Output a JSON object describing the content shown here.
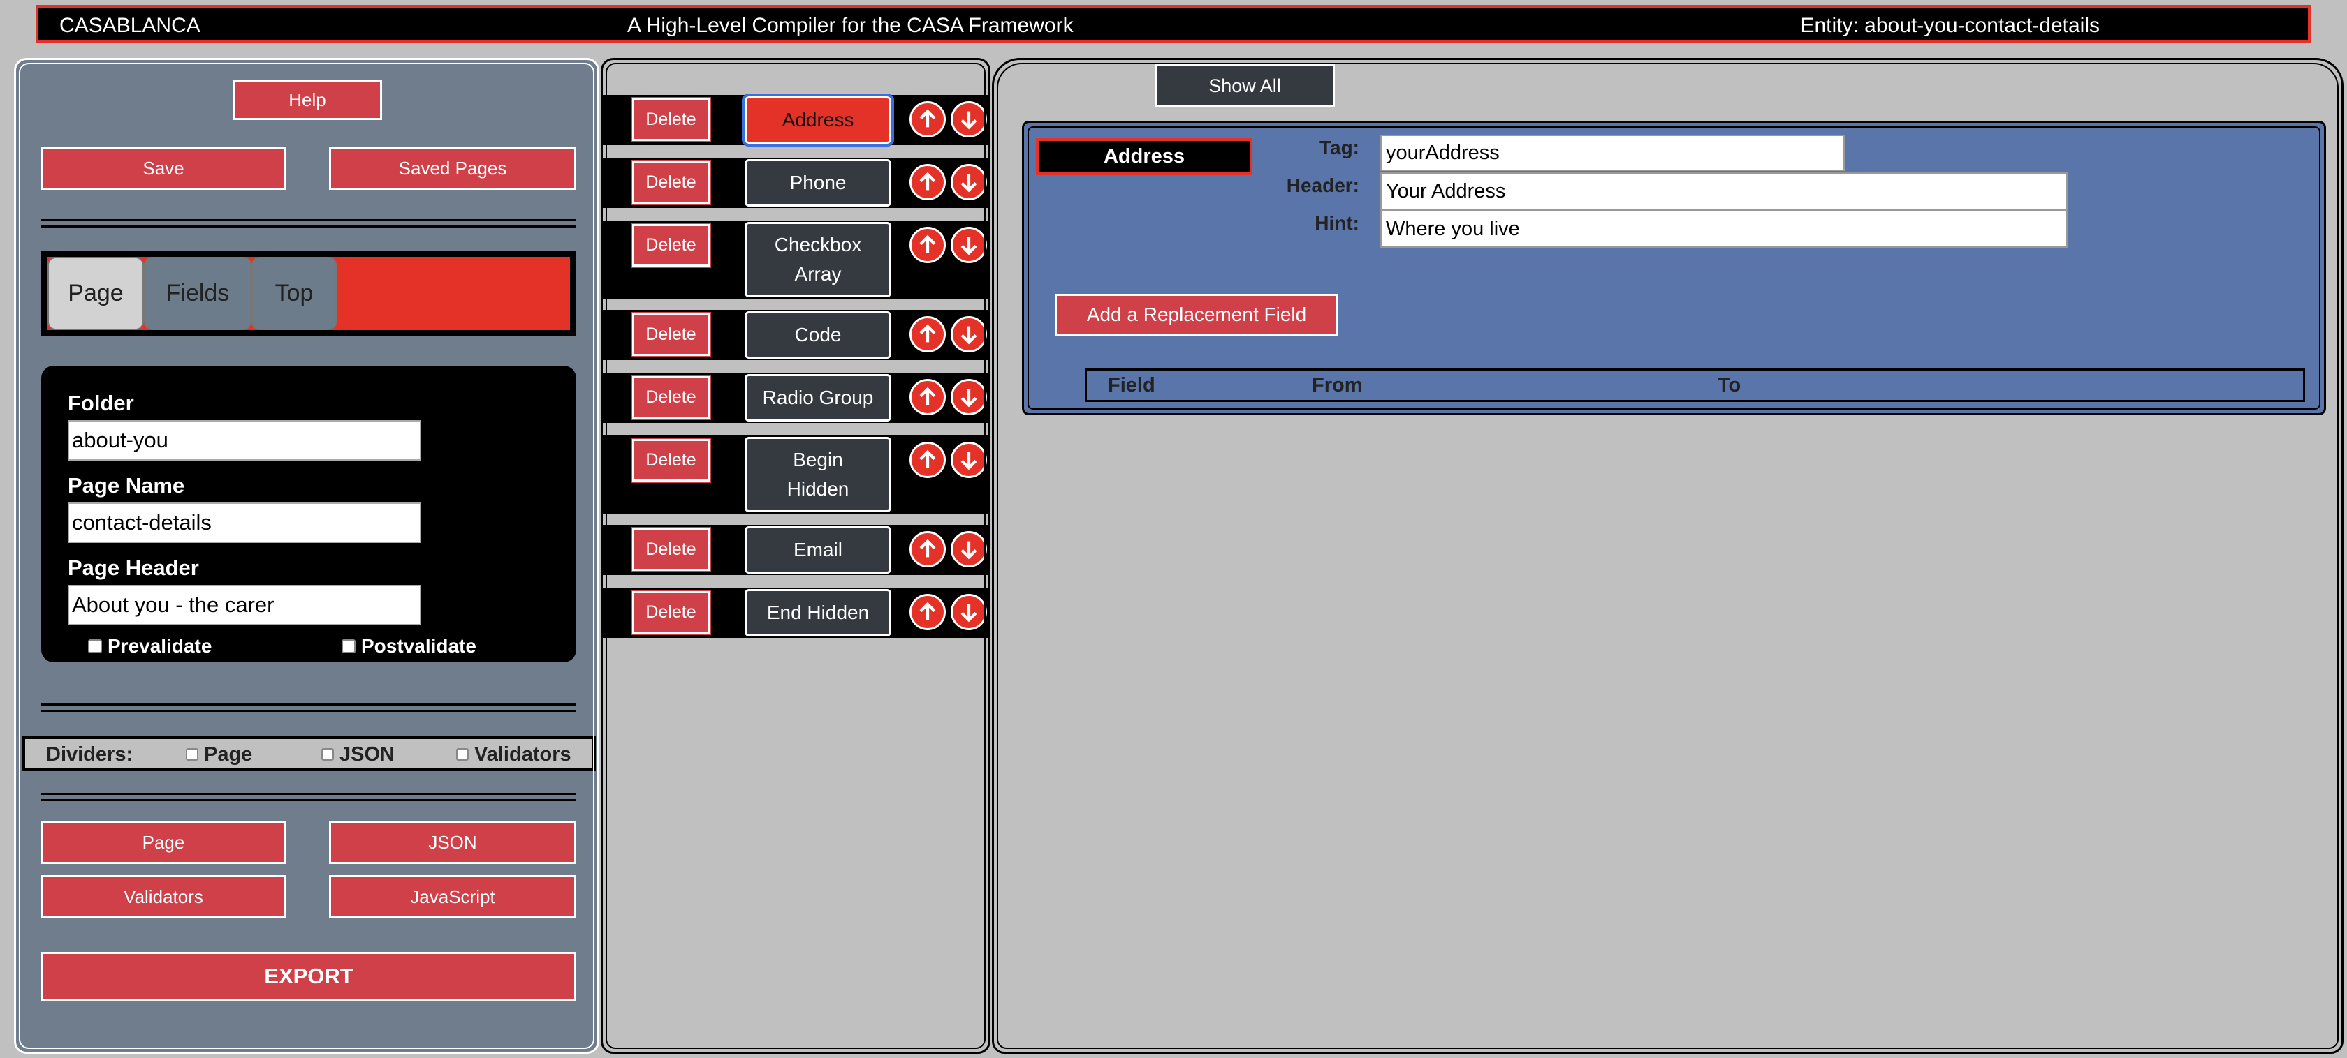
{
  "topbar": {
    "app_name": "CASABLANCA",
    "subtitle": "A High-Level Compiler for the CASA Framework",
    "entity": "Entity: about-you-contact-details"
  },
  "left": {
    "help_label": "Help",
    "save_label": "Save",
    "saved_pages_label": "Saved Pages",
    "tabs": [
      {
        "label": "Page",
        "active": true
      },
      {
        "label": "Fields",
        "active": false
      },
      {
        "label": "Top",
        "active": false
      }
    ],
    "form": {
      "folder_label": "Folder",
      "folder_value": "about-you",
      "page_name_label": "Page Name",
      "page_name_value": "contact-details",
      "page_header_label": "Page Header",
      "page_header_value": "About you - the carer",
      "prevalidate_label": "Prevalidate",
      "postvalidate_label": "Postvalidate"
    },
    "dividers": {
      "label": "Dividers:",
      "options": [
        "Page",
        "JSON",
        "Validators"
      ]
    },
    "buttons": {
      "page": "Page",
      "json": "JSON",
      "validators": "Validators",
      "javascript": "JavaScript",
      "export": "EXPORT"
    }
  },
  "fields_list": {
    "delete_label": "Delete",
    "items": [
      {
        "label": "Address",
        "selected": true
      },
      {
        "label": "Phone",
        "selected": false
      },
      {
        "label": "Checkbox Array",
        "selected": false
      },
      {
        "label": "Code",
        "selected": false
      },
      {
        "label": "Radio Group",
        "selected": false
      },
      {
        "label": "Begin Hidden",
        "selected": false
      },
      {
        "label": "Email",
        "selected": false
      },
      {
        "label": "End Hidden",
        "selected": false
      }
    ]
  },
  "right": {
    "show_all_label": "Show All",
    "field": {
      "name": "Address",
      "tag_label": "Tag:",
      "tag_value": "yourAddress",
      "header_label": "Header:",
      "header_value": "Your Address",
      "hint_label": "Hint:",
      "hint_value": "Where you live",
      "add_replacement_label": "Add a Replacement Field",
      "table_headers": [
        "Field",
        "From",
        "To"
      ]
    }
  },
  "colors": {
    "accent_red": "#e53228",
    "button_red": "#d04049",
    "panel_slate": "#6f7d8c",
    "field_card_blue": "#5975a9",
    "dark_button": "#343a40"
  },
  "icons": {
    "move_up": "arrow-up-icon",
    "move_down": "arrow-down-icon"
  }
}
